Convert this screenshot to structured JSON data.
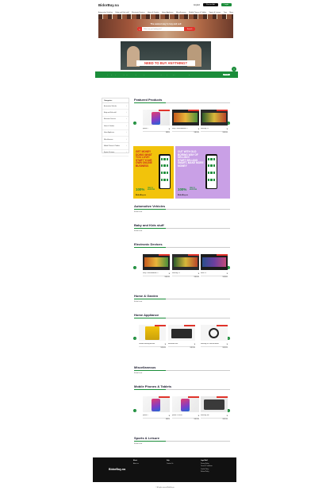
{
  "header": {
    "logo": "BidorBuy.na",
    "language": "English",
    "post_ad": "Post an Ad",
    "login": "Login"
  },
  "nav": [
    "Automotive Vehicles",
    "Baby and Kids stuff",
    "Electronic Devices",
    "Home & Garden",
    "Home Appliance",
    "Miscellaneous",
    "Mobile Phones & Tablets",
    "Sports & Leisure",
    "Toys",
    "More"
  ],
  "hero": {
    "title": "The easiest way to buy and sell",
    "search_placeholder": "What are you looking for?",
    "search_button": "Search"
  },
  "banner": {
    "text": "NEED TO BUY ANYTHING?"
  },
  "cookie": {
    "text": "By clicking \"Accept All Cookies\", you agree to the storing of cookies on your device to enhance site navigation, analyze site usage, and assist in our marketing efforts.",
    "accept": "Accept"
  },
  "sidebar": {
    "title": "Categories",
    "items": [
      "Automotive Vehicles",
      "Baby and Kids stuff",
      "Electronic Devices",
      "Home & Garden",
      "Home Appliance",
      "Miscellaneous",
      "Mobile Phones & Tablets",
      "Sports & Leisure"
    ]
  },
  "featured": {
    "title": "Featured Products",
    "cards": [
      {
        "name": "iphone X",
        "price": "N$950",
        "tag": "Featured Product"
      },
      {
        "name": "Sony X Series Android TV",
        "price": "N$6,500",
        "tag": "Featured Product"
      },
      {
        "name": "Samsung TV",
        "price": "N$4,500",
        "tag": "Featured Product"
      }
    ]
  },
  "promo": [
    {
      "text": "GET MONEY\nDOING WHAT\nYOU LOVE!\nSTART YOUR\nOWN ONLINE\nBUSINESS",
      "percent": "100%",
      "free": "FREE TO\nADVERTISE",
      "brand": "BidorBuy.na"
    },
    {
      "text": "OUT WITH OLD\nBORING WAY OF\nSELLING!\nSTART SELLING\nSMART, MAKE MORE\nMONEY",
      "percent": "100%",
      "free": "FREE TO\nADVERTISE",
      "brand": "BidorBuy.na"
    }
  ],
  "sections": [
    {
      "title": "Automotive Vehicles",
      "no_ads": "No Ads Found"
    },
    {
      "title": "Baby and Kids stuff",
      "no_ads": "No Ads Found"
    },
    {
      "title": "Electronic Devices",
      "cards": [
        {
          "name": "Sony X Series Android TV",
          "price": "N$6,500",
          "tag": "Featured Product"
        },
        {
          "name": "Samsung TV",
          "price": "N$4,500",
          "tag": "Featured Product"
        },
        {
          "name": "Smart TV",
          "price": "N$3,800",
          "tag": "Featured Product"
        }
      ]
    },
    {
      "title": "Home & Garden",
      "no_ads": "No Ads Found"
    },
    {
      "title": "Home Appliance",
      "cards": [
        {
          "name": "Portable Washing Machine",
          "price": "N$1,650",
          "tag": "Featured Product"
        },
        {
          "name": "Microwave oven",
          "price": "N$1,200",
          "tag": "Featured Product"
        },
        {
          "name": "Samsung 20L Solo Microwave",
          "price": "N$1,350",
          "tag": "Featured Product"
        }
      ]
    },
    {
      "title": "Miscellaneous",
      "no_ads": "No Ads Found"
    },
    {
      "title": "Mobile Phones & Tablets",
      "cards": [
        {
          "name": "iphone X",
          "price": "N$950",
          "tag": "Featured Product"
        },
        {
          "name": "Iphone X 256GB",
          "price": "N$1,200",
          "tag": "Featured Product"
        },
        {
          "name": "Samsung Tab",
          "price": "N$2,100",
          "tag": "Featured Product"
        }
      ]
    },
    {
      "title": "Sports & Leisure",
      "no_ads": "No Ads Found"
    }
  ],
  "footer": {
    "logo": "BidorBuy.na",
    "col1_title": "About",
    "col1": [
      "About us"
    ],
    "col2_title": "Help",
    "col2": [
      "Contact Us"
    ],
    "col3_title": "Legal Stuff",
    "col3": [
      "Privacy Policy",
      "Terms & Conditions",
      "Cookie Policy",
      "Refund Policy"
    ],
    "copyright": "© All rights reserved BidorBuy.na"
  },
  "colors": {
    "accent": "#1b8d3a",
    "red": "#e0342b",
    "footer": "#111111"
  }
}
